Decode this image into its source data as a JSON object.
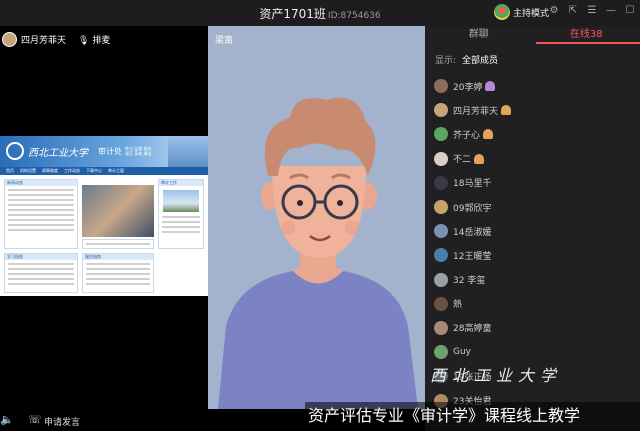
{
  "window": {
    "title": "资产1701班",
    "room_id": "ID:8754636",
    "host_label": "主持模式"
  },
  "left_panel": {
    "user_name": "四月芳菲天",
    "mic_label": "排麦"
  },
  "web_capture": {
    "school": "西北工业大学",
    "dept": "审计处",
    "slogan_lines": [
      "依法 监督 服务",
      "规范 高效 廉洁"
    ],
    "nav": [
      "首页",
      "机构设置",
      "规章制度",
      "工作动态",
      "下载中心",
      "审计之窗"
    ],
    "sections": [
      "新闻动态",
      "学习园地",
      "审计工作",
      "服务指南"
    ]
  },
  "center": {
    "name": "梁甯"
  },
  "sidebar": {
    "tabs": [
      "群聊",
      "在线38"
    ],
    "filter_label": "显示:",
    "filter_value": "全部成员",
    "members": [
      {
        "name": "20李婷",
        "avatar": "#8a6d5c",
        "badge": "#b38ad8"
      },
      {
        "name": "四月芳菲天",
        "avatar": "#c9a37a",
        "badge": "#e3a35a"
      },
      {
        "name": "芥子心",
        "avatar": "#5aa860",
        "badge": "#e3a35a"
      },
      {
        "name": "不二",
        "avatar": "#d9cfc3",
        "badge": "#e3a35a"
      },
      {
        "name": "18马里千",
        "avatar": "#3a3a4a",
        "badge": ""
      },
      {
        "name": "09郭欣宇",
        "avatar": "#c4a36b",
        "badge": ""
      },
      {
        "name": "14岳淑媛",
        "avatar": "#7d8fb5",
        "badge": ""
      },
      {
        "name": "12王暖莹",
        "avatar": "#4a7fa8",
        "badge": ""
      },
      {
        "name": "32 李玺",
        "avatar": "#9aa0a8",
        "badge": ""
      },
      {
        "name": "熱",
        "avatar": "#6a5240",
        "badge": ""
      },
      {
        "name": "28高婷童",
        "avatar": "#a88a7a",
        "badge": ""
      },
      {
        "name": "Guy",
        "avatar": "#6ea070",
        "badge": ""
      },
      {
        "name": "19张正扬",
        "avatar": "#5a6070",
        "badge": ""
      },
      {
        "name": "23关怡君",
        "avatar": "#b08a60",
        "badge": ""
      }
    ]
  },
  "bottom": {
    "apply_label": "申请发言"
  },
  "overlay": {
    "subtitle": "资产评估专业《审计学》课程线上教学",
    "watermark": "西北工业大学"
  },
  "colors": {
    "accent": "#f25a5a",
    "cartoon_bg": "#a4b3cd",
    "sidebar_bg": "#202022"
  }
}
